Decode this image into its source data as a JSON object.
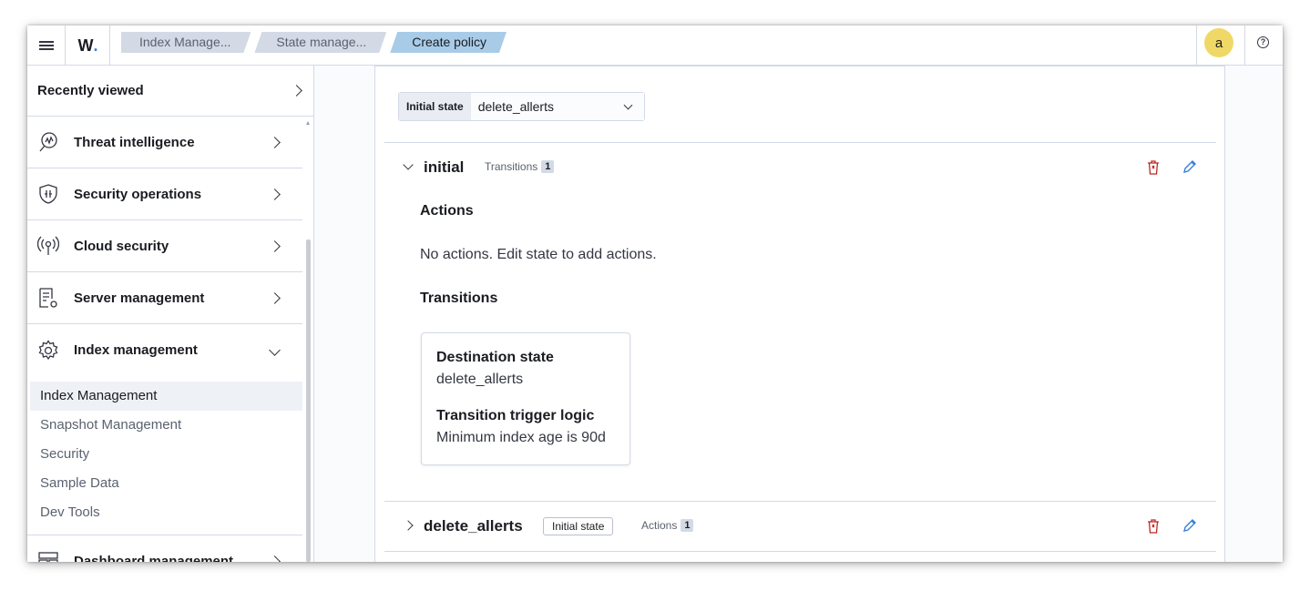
{
  "header": {
    "breadcrumbs": [
      "Index Manage...",
      "State manage...",
      "Create policy"
    ],
    "avatar_letter": "a",
    "help_glyph": "?"
  },
  "sidebar": {
    "recently_viewed": "Recently viewed",
    "items": [
      {
        "label": "Threat intelligence",
        "icon": "threat-intelligence-icon"
      },
      {
        "label": "Security operations",
        "icon": "shield-icon"
      },
      {
        "label": "Cloud security",
        "icon": "broadcast-icon"
      },
      {
        "label": "Server management",
        "icon": "server-doc-icon"
      },
      {
        "label": "Index management",
        "icon": "gear-icon",
        "expanded": true
      }
    ],
    "sub_items": [
      "Index Management",
      "Snapshot Management",
      "Security",
      "Sample Data",
      "Dev Tools"
    ],
    "next_item": {
      "label": "Dashboard management",
      "icon": "dashboard-icon"
    }
  },
  "policy": {
    "initial_state_label": "Initial state",
    "initial_state_value": "delete_allerts",
    "states": [
      {
        "name": "initial",
        "transitions_label": "Transitions",
        "transitions_count": "1",
        "actions_title": "Actions",
        "no_actions_text": "No actions. Edit state to add actions.",
        "transitions_title": "Transitions",
        "card": {
          "destination_title": "Destination state",
          "destination_value": "delete_allerts",
          "trigger_title": "Transition trigger logic",
          "trigger_value": "Minimum index age is 90d"
        }
      },
      {
        "name": "delete_allerts",
        "badge": "Initial state",
        "actions_label": "Actions",
        "actions_count": "1"
      }
    ]
  },
  "colors": {
    "accent": "#3a7fd5",
    "danger": "#bd271e",
    "avatar": "#f0d866",
    "crumb_active": "#a8cbe8"
  }
}
